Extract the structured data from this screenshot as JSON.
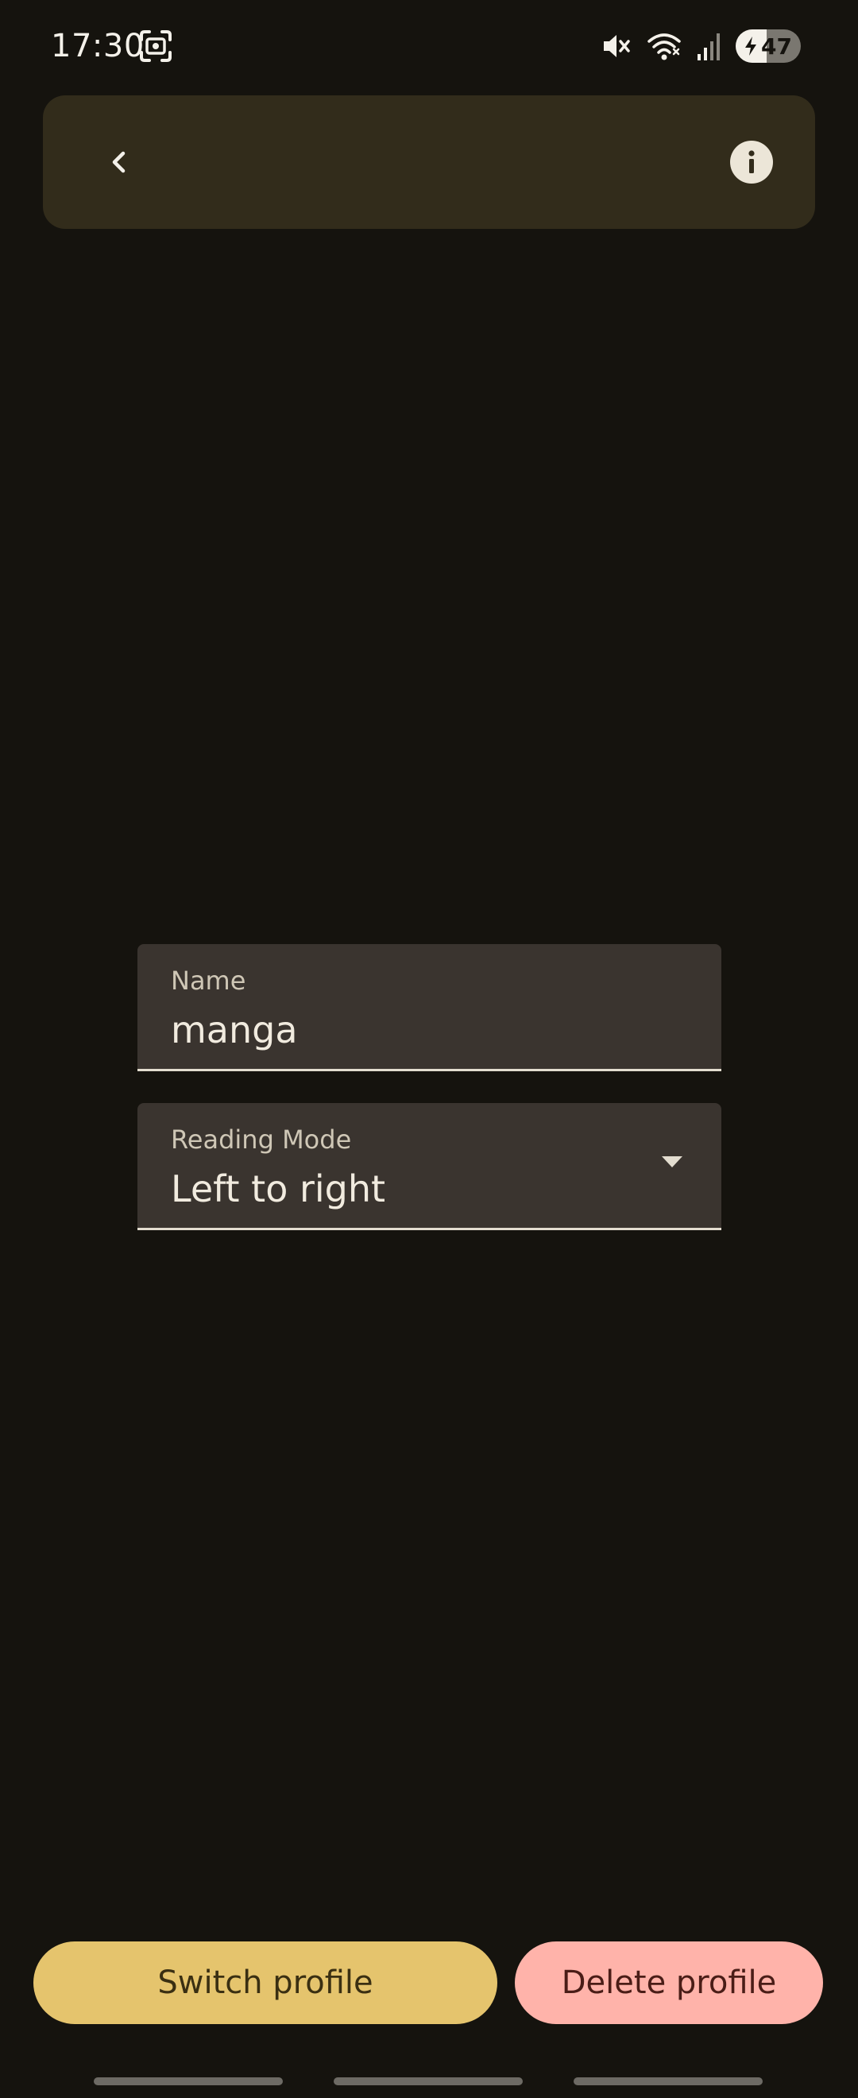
{
  "status_bar": {
    "time": "17:30",
    "battery_level": "47",
    "battery_fraction": 0.47,
    "icons": [
      "screenshot-icon",
      "mute-icon",
      "wifi-icon",
      "signal-icon",
      "battery-charging-icon"
    ]
  },
  "top_bar": {
    "back_icon": "chevron-left-icon",
    "info_icon": "info-icon"
  },
  "form": {
    "name_label": "Name",
    "name_value": "manga",
    "mode_label": "Reading Mode",
    "mode_value": "Left to right",
    "mode_icon": "dropdown-arrow-icon"
  },
  "actions": {
    "switch_label": "Switch profile",
    "delete_label": "Delete profile"
  },
  "colors": {
    "background": "#15130e",
    "top_bar": "#322c1b",
    "field": "#3a342f",
    "primary_button": "#e5c46d",
    "danger_button": "#ffb3aa"
  }
}
